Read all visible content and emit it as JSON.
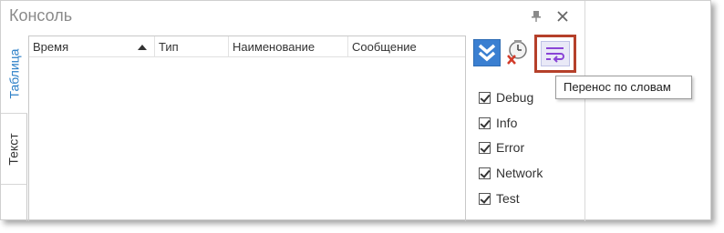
{
  "window": {
    "title": "Консоль"
  },
  "tabs": [
    {
      "label": "Таблица",
      "active": true
    },
    {
      "label": "Текст",
      "active": false
    }
  ],
  "grid": {
    "columns": [
      {
        "label": "Время",
        "sorted": "ascending"
      },
      {
        "label": "Тип"
      },
      {
        "label": "Наименование"
      },
      {
        "label": "Сообщение"
      }
    ],
    "rows": []
  },
  "toolbar": {
    "scroll_icon": "double-chevron-down-icon",
    "clear_icon": "clock-clear-icon",
    "wrap_icon": "word-wrap-icon",
    "wrap_tooltip": "Перенос по словам",
    "accent_color": "#3a7fd1",
    "highlight_color": "#b5402a"
  },
  "filters": [
    {
      "label": "Debug",
      "checked": true
    },
    {
      "label": "Info",
      "checked": true
    },
    {
      "label": "Error",
      "checked": true
    },
    {
      "label": "Network",
      "checked": true
    },
    {
      "label": "Test",
      "checked": true
    }
  ]
}
